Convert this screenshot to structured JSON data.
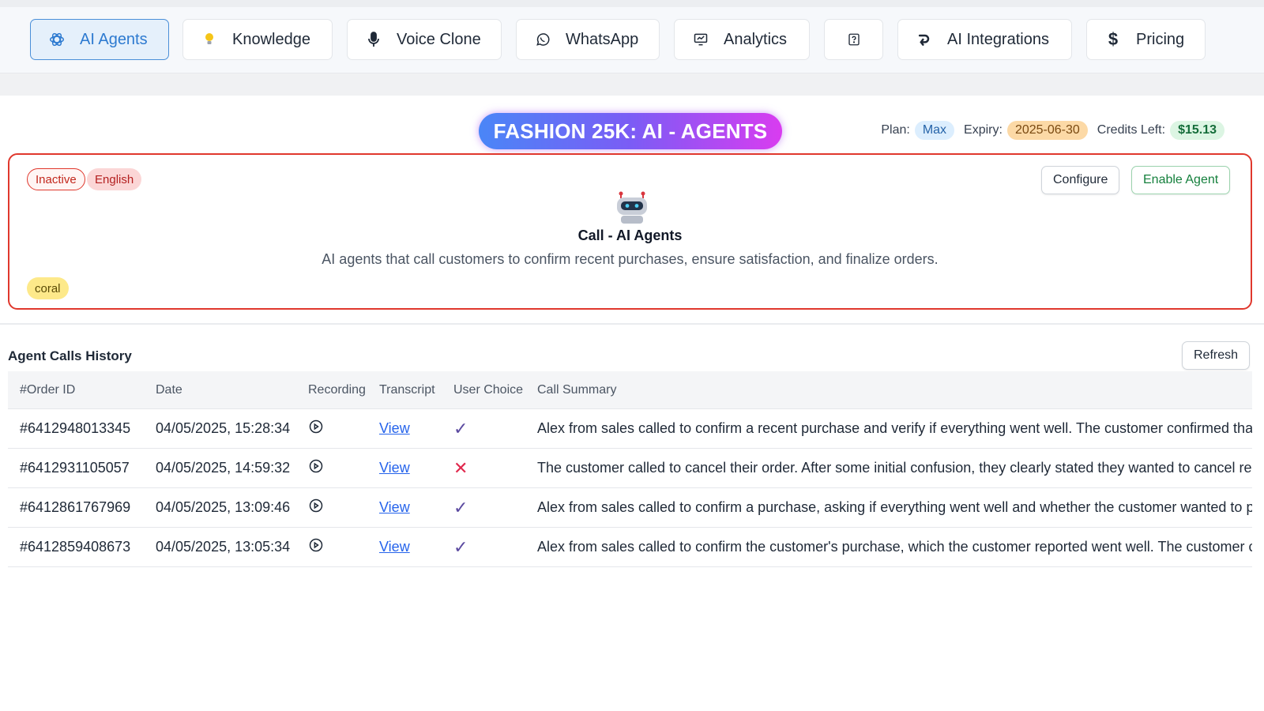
{
  "nav": {
    "tabs": [
      {
        "label": "AI Agents",
        "icon": "openai-icon",
        "active": true
      },
      {
        "label": "Knowledge",
        "icon": "lightbulb-icon"
      },
      {
        "label": "Voice Clone",
        "icon": "microphone-icon"
      },
      {
        "label": "WhatsApp",
        "icon": "whatsapp-icon"
      },
      {
        "label": "Analytics",
        "icon": "analytics-icon"
      },
      {
        "label": "",
        "icon": "help-icon"
      },
      {
        "label": "AI Integrations",
        "icon": "integration-icon"
      },
      {
        "label": "Pricing",
        "icon": "dollar-icon"
      }
    ]
  },
  "header": {
    "title": "FASHION 25K: AI - AGENTS",
    "plan_label": "Plan:",
    "plan": "Max",
    "expiry_label": "Expiry:",
    "expiry": "2025-06-30",
    "credits_label": "Credits Left:",
    "credits": "$15.13"
  },
  "agent": {
    "status": "Inactive",
    "language": "English",
    "color_tag": "coral",
    "name": "Call - AI Agents",
    "description": "AI agents that call customers to confirm recent purchases, ensure satisfaction, and finalize orders.",
    "configure_label": "Configure",
    "enable_label": "Enable Agent"
  },
  "history": {
    "title": "Agent Calls History",
    "refresh_label": "Refresh",
    "columns": [
      "#Order ID",
      "Date",
      "Recording",
      "Transcript",
      "User Choice",
      "Call Summary"
    ],
    "rows": [
      {
        "order_id": "#6412948013345",
        "date": "04/05/2025, 15:28:34",
        "transcript": "View",
        "choice": "✓",
        "summary": "Alex from sales called to confirm a recent purchase and verify if everything went well. The customer confirmed that everything went well."
      },
      {
        "order_id": "#6412931105057",
        "date": "04/05/2025, 14:59:32",
        "transcript": "View",
        "choice": "✕",
        "summary": "The customer called to cancel their order. After some initial confusion, they clearly stated they wanted to cancel regardless."
      },
      {
        "order_id": "#6412861767969",
        "date": "04/05/2025, 13:09:46",
        "transcript": "View",
        "choice": "✓",
        "summary": "Alex from sales called to confirm a purchase, asking if everything went well and whether the customer wanted to proceed."
      },
      {
        "order_id": "#6412859408673",
        "date": "04/05/2025, 13:05:34",
        "transcript": "View",
        "choice": "✓",
        "summary": "Alex from sales called to confirm the customer's purchase, which the customer reported went well. The customer confirmed."
      }
    ]
  },
  "colors": {
    "accent": "#2d7ad0",
    "card_border": "#e0382d",
    "choice_yes": "#5b4aa0",
    "choice_no": "#e0284d"
  }
}
